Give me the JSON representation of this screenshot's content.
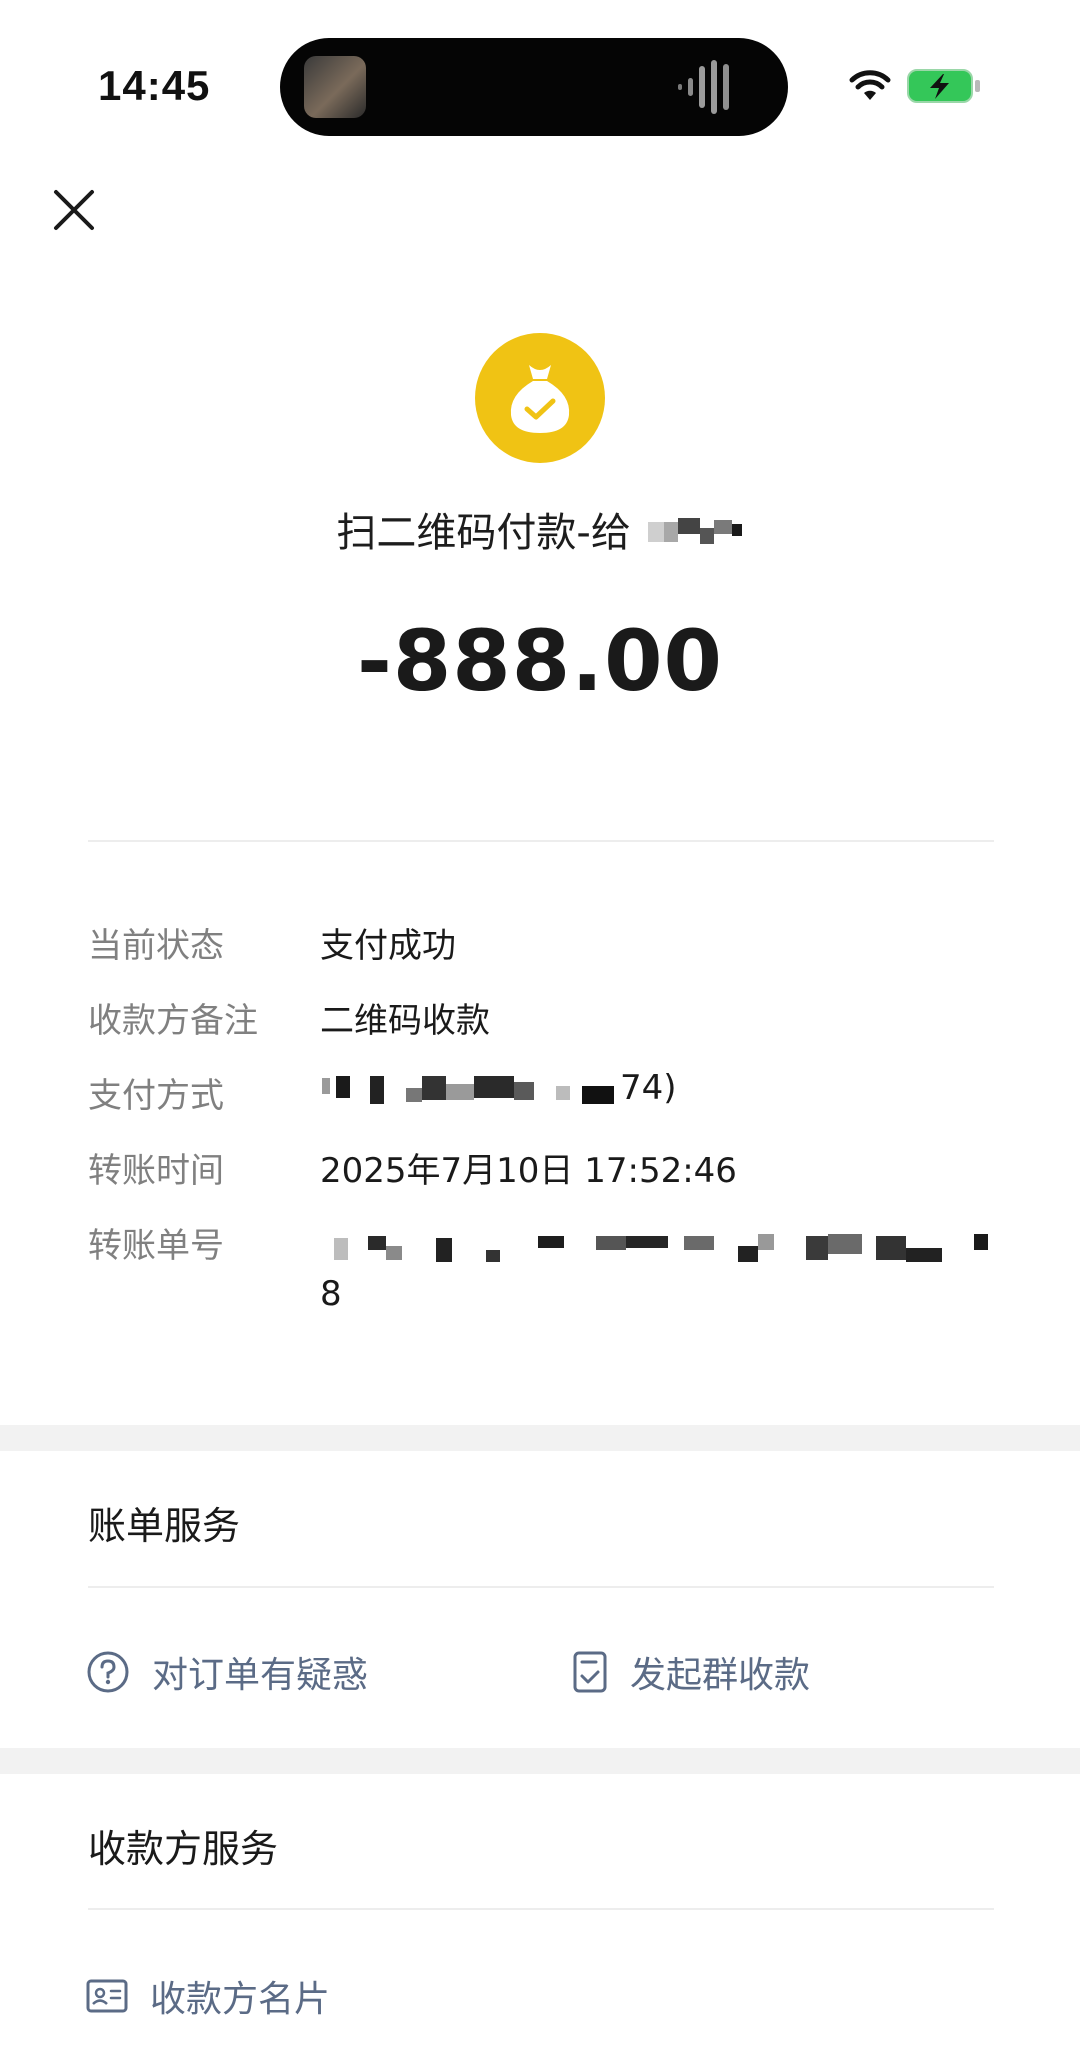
{
  "status_bar": {
    "time": "14:45"
  },
  "header": {
    "title": "扫二维码付款-给",
    "amount": "-888.00",
    "icon": "money-bag-check-icon",
    "icon_color": "#F0C314"
  },
  "details": {
    "status": {
      "label": "当前状态",
      "value": "支付成功"
    },
    "remark": {
      "label": "收款方备注",
      "value": "二维码收款"
    },
    "method": {
      "label": "支付方式",
      "value_suffix": "74)"
    },
    "time": {
      "label": "转账时间",
      "value": "2025年7月10日 17:52:46"
    },
    "order_no": {
      "label": "转账单号",
      "value_tail": "8"
    }
  },
  "bill_service": {
    "title": "账单服务",
    "items": [
      {
        "label": "对订单有疑惑",
        "icon": "question-circle-icon"
      },
      {
        "label": "发起群收款",
        "icon": "document-check-icon"
      }
    ]
  },
  "payee_service": {
    "title": "收款方服务",
    "items": [
      {
        "label": "收款方名片",
        "icon": "contact-card-icon"
      }
    ]
  },
  "colors": {
    "link": "#5B6B86",
    "label_gray": "#808080",
    "section_bg": "#F2F2F2"
  }
}
